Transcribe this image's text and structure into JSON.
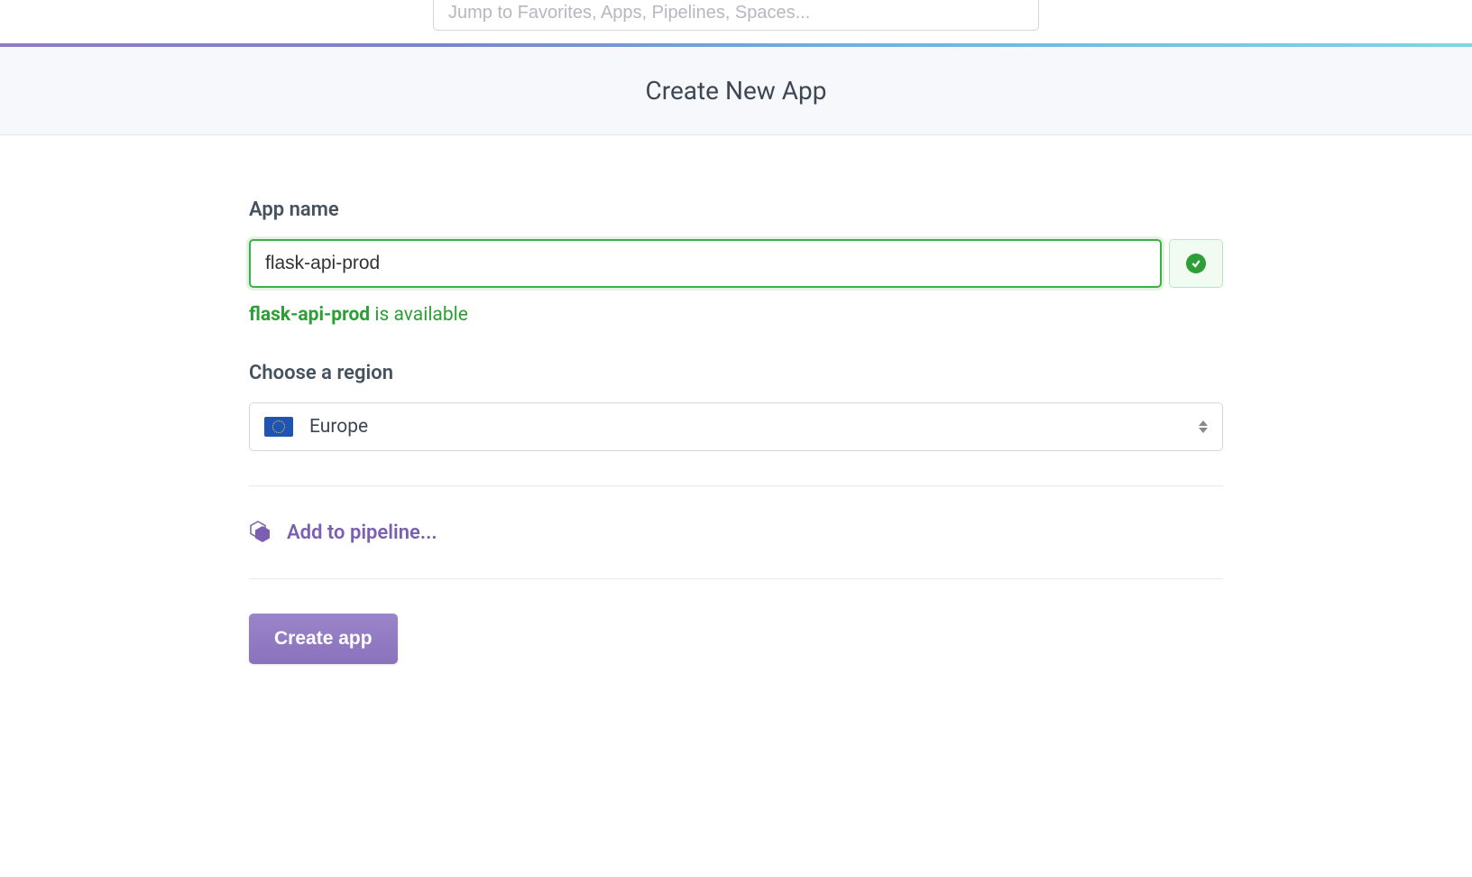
{
  "topbar": {
    "search_placeholder": "Jump to Favorites, Apps, Pipelines, Spaces..."
  },
  "header": {
    "title": "Create New App"
  },
  "form": {
    "app_name": {
      "label": "App name",
      "value": "flask-api-prod",
      "availability_name": "flask-api-prod",
      "availability_suffix": " is available"
    },
    "region": {
      "label": "Choose a region",
      "selected": "Europe"
    },
    "pipeline": {
      "label": "Add to pipeline..."
    },
    "submit": {
      "label": "Create app"
    }
  }
}
